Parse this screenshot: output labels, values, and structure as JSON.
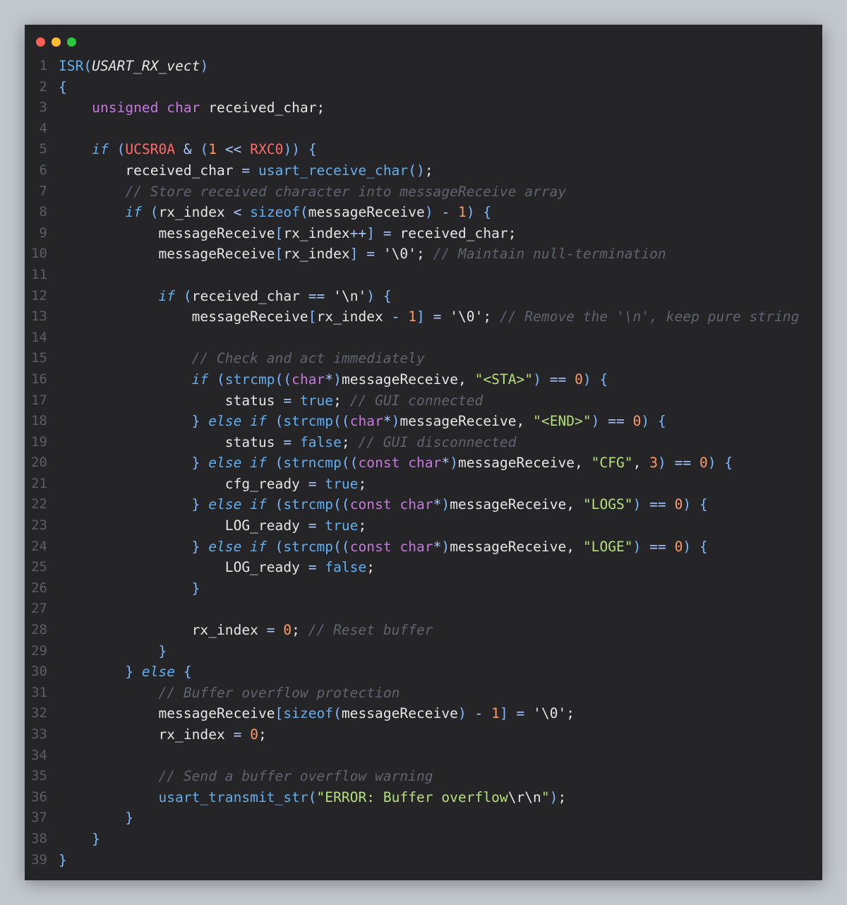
{
  "window": {
    "controls": [
      "close",
      "minimize",
      "maximize"
    ]
  },
  "code_lines": [
    [
      [
        "fn",
        "ISR"
      ],
      [
        "br",
        "("
      ],
      [
        "ital",
        "USART_RX_vect"
      ],
      [
        "br",
        ")"
      ]
    ],
    [
      [
        "br",
        "{"
      ]
    ],
    [
      [
        "dft",
        "    "
      ],
      [
        "kw",
        "unsigned"
      ],
      [
        "dft",
        " "
      ],
      [
        "kw",
        "char"
      ],
      [
        "dft",
        " received_char;"
      ]
    ],
    [],
    [
      [
        "dft",
        "    "
      ],
      [
        "ctl",
        "if"
      ],
      [
        "dft",
        " "
      ],
      [
        "br",
        "("
      ],
      [
        "reg",
        "UCSR0A"
      ],
      [
        "dft",
        " "
      ],
      [
        "op",
        "&"
      ],
      [
        "dft",
        " "
      ],
      [
        "br",
        "("
      ],
      [
        "num",
        "1"
      ],
      [
        "dft",
        " "
      ],
      [
        "op",
        "<<"
      ],
      [
        "dft",
        " "
      ],
      [
        "reg",
        "RXC0"
      ],
      [
        "br",
        "))"
      ],
      [
        "dft",
        " "
      ],
      [
        "br",
        "{"
      ]
    ],
    [
      [
        "dft",
        "        received_char "
      ],
      [
        "op",
        "="
      ],
      [
        "dft",
        " "
      ],
      [
        "fn",
        "usart_receive_char"
      ],
      [
        "br",
        "()"
      ],
      [
        "dft",
        ";"
      ]
    ],
    [
      [
        "dft",
        "        "
      ],
      [
        "cm",
        "// Store received character into messageReceive array"
      ]
    ],
    [
      [
        "dft",
        "        "
      ],
      [
        "ctl",
        "if"
      ],
      [
        "dft",
        " "
      ],
      [
        "br",
        "("
      ],
      [
        "dft",
        "rx_index "
      ],
      [
        "op",
        "<"
      ],
      [
        "dft",
        " "
      ],
      [
        "fn",
        "sizeof"
      ],
      [
        "br",
        "("
      ],
      [
        "dft",
        "messageReceive"
      ],
      [
        "br",
        ")"
      ],
      [
        "dft",
        " "
      ],
      [
        "op",
        "-"
      ],
      [
        "dft",
        " "
      ],
      [
        "num",
        "1"
      ],
      [
        "br",
        ")"
      ],
      [
        "dft",
        " "
      ],
      [
        "br",
        "{"
      ]
    ],
    [
      [
        "dft",
        "            messageReceive"
      ],
      [
        "br",
        "["
      ],
      [
        "dft",
        "rx_index"
      ],
      [
        "op",
        "++"
      ],
      [
        "br",
        "]"
      ],
      [
        "dft",
        " "
      ],
      [
        "op",
        "="
      ],
      [
        "dft",
        " received_char;"
      ]
    ],
    [
      [
        "dft",
        "            messageReceive"
      ],
      [
        "br",
        "["
      ],
      [
        "dft",
        "rx_index"
      ],
      [
        "br",
        "]"
      ],
      [
        "dft",
        " "
      ],
      [
        "op",
        "="
      ],
      [
        "dft",
        " '\\0'; "
      ],
      [
        "cm",
        "// Maintain null-termination"
      ]
    ],
    [],
    [
      [
        "dft",
        "            "
      ],
      [
        "ctl",
        "if"
      ],
      [
        "dft",
        " "
      ],
      [
        "br",
        "("
      ],
      [
        "dft",
        "received_char "
      ],
      [
        "op",
        "=="
      ],
      [
        "dft",
        " '\\n'"
      ],
      [
        "br",
        ")"
      ],
      [
        "dft",
        " "
      ],
      [
        "br",
        "{"
      ]
    ],
    [
      [
        "dft",
        "                messageReceive"
      ],
      [
        "br",
        "["
      ],
      [
        "dft",
        "rx_index "
      ],
      [
        "op",
        "-"
      ],
      [
        "dft",
        " "
      ],
      [
        "num",
        "1"
      ],
      [
        "br",
        "]"
      ],
      [
        "dft",
        " "
      ],
      [
        "op",
        "="
      ],
      [
        "dft",
        " '\\0'; "
      ],
      [
        "cm",
        "// Remove the '\\n', keep pure string"
      ]
    ],
    [],
    [
      [
        "dft",
        "                "
      ],
      [
        "cm",
        "// Check and act immediately"
      ]
    ],
    [
      [
        "dft",
        "                "
      ],
      [
        "ctl",
        "if"
      ],
      [
        "dft",
        " "
      ],
      [
        "br",
        "("
      ],
      [
        "fn",
        "strcmp"
      ],
      [
        "br",
        "(("
      ],
      [
        "kw",
        "char"
      ],
      [
        "op",
        "*"
      ],
      [
        "br",
        ")"
      ],
      [
        "dft",
        "messageReceive, "
      ],
      [
        "str",
        "\"<STA>\""
      ],
      [
        "br",
        ")"
      ],
      [
        "dft",
        " "
      ],
      [
        "op",
        "=="
      ],
      [
        "dft",
        " "
      ],
      [
        "num",
        "0"
      ],
      [
        "br",
        ")"
      ],
      [
        "dft",
        " "
      ],
      [
        "br",
        "{"
      ]
    ],
    [
      [
        "dft",
        "                    status "
      ],
      [
        "op",
        "="
      ],
      [
        "dft",
        " "
      ],
      [
        "fn",
        "true"
      ],
      [
        "dft",
        "; "
      ],
      [
        "cm",
        "// GUI connected"
      ]
    ],
    [
      [
        "dft",
        "                "
      ],
      [
        "br",
        "}"
      ],
      [
        "dft",
        " "
      ],
      [
        "ctl",
        "else if"
      ],
      [
        "dft",
        " "
      ],
      [
        "br",
        "("
      ],
      [
        "fn",
        "strcmp"
      ],
      [
        "br",
        "(("
      ],
      [
        "kw",
        "char"
      ],
      [
        "op",
        "*"
      ],
      [
        "br",
        ")"
      ],
      [
        "dft",
        "messageReceive, "
      ],
      [
        "str",
        "\"<END>\""
      ],
      [
        "br",
        ")"
      ],
      [
        "dft",
        " "
      ],
      [
        "op",
        "=="
      ],
      [
        "dft",
        " "
      ],
      [
        "num",
        "0"
      ],
      [
        "br",
        ")"
      ],
      [
        "dft",
        " "
      ],
      [
        "br",
        "{"
      ]
    ],
    [
      [
        "dft",
        "                    status "
      ],
      [
        "op",
        "="
      ],
      [
        "dft",
        " "
      ],
      [
        "fn",
        "false"
      ],
      [
        "dft",
        "; "
      ],
      [
        "cm",
        "// GUI disconnected"
      ]
    ],
    [
      [
        "dft",
        "                "
      ],
      [
        "br",
        "}"
      ],
      [
        "dft",
        " "
      ],
      [
        "ctl",
        "else if"
      ],
      [
        "dft",
        " "
      ],
      [
        "br",
        "("
      ],
      [
        "fn",
        "strncmp"
      ],
      [
        "br",
        "(("
      ],
      [
        "kw",
        "const"
      ],
      [
        "dft",
        " "
      ],
      [
        "kw",
        "char"
      ],
      [
        "op",
        "*"
      ],
      [
        "br",
        ")"
      ],
      [
        "dft",
        "messageReceive, "
      ],
      [
        "str",
        "\"CFG\""
      ],
      [
        "dft",
        ", "
      ],
      [
        "num",
        "3"
      ],
      [
        "br",
        ")"
      ],
      [
        "dft",
        " "
      ],
      [
        "op",
        "=="
      ],
      [
        "dft",
        " "
      ],
      [
        "num",
        "0"
      ],
      [
        "br",
        ")"
      ],
      [
        "dft",
        " "
      ],
      [
        "br",
        "{"
      ]
    ],
    [
      [
        "dft",
        "                    cfg_ready "
      ],
      [
        "op",
        "="
      ],
      [
        "dft",
        " "
      ],
      [
        "fn",
        "true"
      ],
      [
        "dft",
        ";"
      ]
    ],
    [
      [
        "dft",
        "                "
      ],
      [
        "br",
        "}"
      ],
      [
        "dft",
        " "
      ],
      [
        "ctl",
        "else if"
      ],
      [
        "dft",
        " "
      ],
      [
        "br",
        "("
      ],
      [
        "fn",
        "strcmp"
      ],
      [
        "br",
        "(("
      ],
      [
        "kw",
        "const"
      ],
      [
        "dft",
        " "
      ],
      [
        "kw",
        "char"
      ],
      [
        "op",
        "*"
      ],
      [
        "br",
        ")"
      ],
      [
        "dft",
        "messageReceive, "
      ],
      [
        "str",
        "\"LOGS\""
      ],
      [
        "br",
        ")"
      ],
      [
        "dft",
        " "
      ],
      [
        "op",
        "=="
      ],
      [
        "dft",
        " "
      ],
      [
        "num",
        "0"
      ],
      [
        "br",
        ")"
      ],
      [
        "dft",
        " "
      ],
      [
        "br",
        "{"
      ]
    ],
    [
      [
        "dft",
        "                    LOG_ready "
      ],
      [
        "op",
        "="
      ],
      [
        "dft",
        " "
      ],
      [
        "fn",
        "true"
      ],
      [
        "dft",
        ";"
      ]
    ],
    [
      [
        "dft",
        "                "
      ],
      [
        "br",
        "}"
      ],
      [
        "dft",
        " "
      ],
      [
        "ctl",
        "else if"
      ],
      [
        "dft",
        " "
      ],
      [
        "br",
        "("
      ],
      [
        "fn",
        "strcmp"
      ],
      [
        "br",
        "(("
      ],
      [
        "kw",
        "const"
      ],
      [
        "dft",
        " "
      ],
      [
        "kw",
        "char"
      ],
      [
        "op",
        "*"
      ],
      [
        "br",
        ")"
      ],
      [
        "dft",
        "messageReceive, "
      ],
      [
        "str",
        "\"LOGE\""
      ],
      [
        "br",
        ")"
      ],
      [
        "dft",
        " "
      ],
      [
        "op",
        "=="
      ],
      [
        "dft",
        " "
      ],
      [
        "num",
        "0"
      ],
      [
        "br",
        ")"
      ],
      [
        "dft",
        " "
      ],
      [
        "br",
        "{"
      ]
    ],
    [
      [
        "dft",
        "                    LOG_ready "
      ],
      [
        "op",
        "="
      ],
      [
        "dft",
        " "
      ],
      [
        "fn",
        "false"
      ],
      [
        "dft",
        ";"
      ]
    ],
    [
      [
        "dft",
        "                "
      ],
      [
        "br",
        "}"
      ]
    ],
    [],
    [
      [
        "dft",
        "                rx_index "
      ],
      [
        "op",
        "="
      ],
      [
        "dft",
        " "
      ],
      [
        "num",
        "0"
      ],
      [
        "dft",
        "; "
      ],
      [
        "cm",
        "// Reset buffer"
      ]
    ],
    [
      [
        "dft",
        "            "
      ],
      [
        "br",
        "}"
      ]
    ],
    [
      [
        "dft",
        "        "
      ],
      [
        "br",
        "}"
      ],
      [
        "dft",
        " "
      ],
      [
        "ctl",
        "else"
      ],
      [
        "dft",
        " "
      ],
      [
        "br",
        "{"
      ]
    ],
    [
      [
        "dft",
        "            "
      ],
      [
        "cm",
        "// Buffer overflow protection"
      ]
    ],
    [
      [
        "dft",
        "            messageReceive"
      ],
      [
        "br",
        "["
      ],
      [
        "fn",
        "sizeof"
      ],
      [
        "br",
        "("
      ],
      [
        "dft",
        "messageReceive"
      ],
      [
        "br",
        ")"
      ],
      [
        "dft",
        " "
      ],
      [
        "op",
        "-"
      ],
      [
        "dft",
        " "
      ],
      [
        "num",
        "1"
      ],
      [
        "br",
        "]"
      ],
      [
        "dft",
        " "
      ],
      [
        "op",
        "="
      ],
      [
        "dft",
        " '\\0';"
      ]
    ],
    [
      [
        "dft",
        "            rx_index "
      ],
      [
        "op",
        "="
      ],
      [
        "dft",
        " "
      ],
      [
        "num",
        "0"
      ],
      [
        "dft",
        ";"
      ]
    ],
    [],
    [
      [
        "dft",
        "            "
      ],
      [
        "cm",
        "// Send a buffer overflow warning"
      ]
    ],
    [
      [
        "dft",
        "            "
      ],
      [
        "fn",
        "usart_transmit_str"
      ],
      [
        "br",
        "("
      ],
      [
        "str",
        "\"ERROR: Buffer overflow"
      ],
      [
        "dft",
        "\\r\\n"
      ],
      [
        "str",
        "\""
      ],
      [
        "br",
        ")"
      ],
      [
        "dft",
        ";"
      ]
    ],
    [
      [
        "dft",
        "        "
      ],
      [
        "br",
        "}"
      ]
    ],
    [
      [
        "dft",
        "    "
      ],
      [
        "br",
        "}"
      ]
    ],
    [
      [
        "br",
        "}"
      ]
    ]
  ]
}
